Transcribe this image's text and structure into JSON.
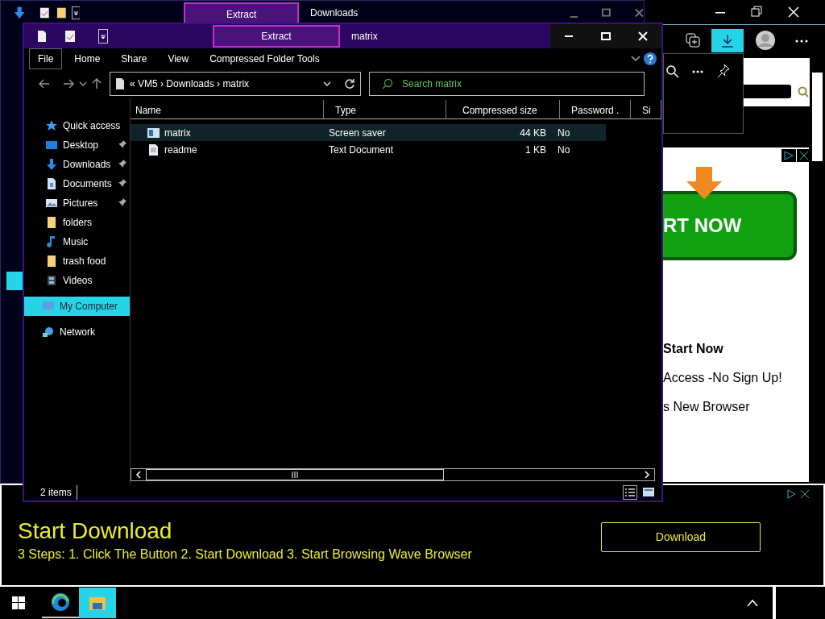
{
  "back_window": {
    "tab": "Extract",
    "title": "Downloads"
  },
  "explorer": {
    "tab": "Extract",
    "title": "matrix",
    "ribbon": [
      {
        "label": "File",
        "selected": true
      },
      {
        "label": "Home",
        "selected": false
      },
      {
        "label": "Share",
        "selected": false
      },
      {
        "label": "View",
        "selected": false
      },
      {
        "label": "Compressed Folder Tools",
        "selected": false
      }
    ],
    "path": "« VM5 › Downloads › matrix",
    "search": {
      "placeholder": "Search matrix"
    },
    "sidebar": [
      {
        "label": "Quick access",
        "kind": "star",
        "pinned": false,
        "selected": false
      },
      {
        "label": "Desktop",
        "kind": "desktop",
        "pinned": true,
        "selected": false
      },
      {
        "label": "Downloads",
        "kind": "download",
        "pinned": true,
        "selected": false
      },
      {
        "label": "Documents",
        "kind": "document",
        "pinned": true,
        "selected": false
      },
      {
        "label": "Pictures",
        "kind": "pictures",
        "pinned": true,
        "selected": false
      },
      {
        "label": "folders",
        "kind": "folder",
        "pinned": false,
        "selected": false
      },
      {
        "label": "Music",
        "kind": "music",
        "pinned": false,
        "selected": false
      },
      {
        "label": "trash food",
        "kind": "folder",
        "pinned": false,
        "selected": false
      },
      {
        "label": "Videos",
        "kind": "videos",
        "pinned": false,
        "selected": false
      },
      {
        "label": "My Computer",
        "kind": "computer",
        "pinned": false,
        "selected": true
      },
      {
        "label": "Network",
        "kind": "network",
        "pinned": false,
        "selected": false
      }
    ],
    "columns": [
      "Name",
      "Type",
      "Compressed size",
      "Password .",
      "Si"
    ],
    "files": [
      {
        "name": "matrix",
        "kind": "screensaver",
        "type": "Screen saver",
        "compressed_size": "44 KB",
        "password": "No",
        "selected": true
      },
      {
        "name": "readme",
        "kind": "text",
        "type": "Text Document",
        "compressed_size": "1 KB",
        "password": "No",
        "selected": false
      }
    ],
    "status_bar": "2 items"
  },
  "side_ad": {
    "banner": "RT NOW",
    "lines": [
      "Start Now",
      "Access -No Sign Up!",
      "s New Browser"
    ]
  },
  "bottom_ad": {
    "title": "Start Download",
    "text": "3 Steps: 1. Click The Button 2. Start Download 3. Start Browsing Wave Browser",
    "button": "Download"
  }
}
